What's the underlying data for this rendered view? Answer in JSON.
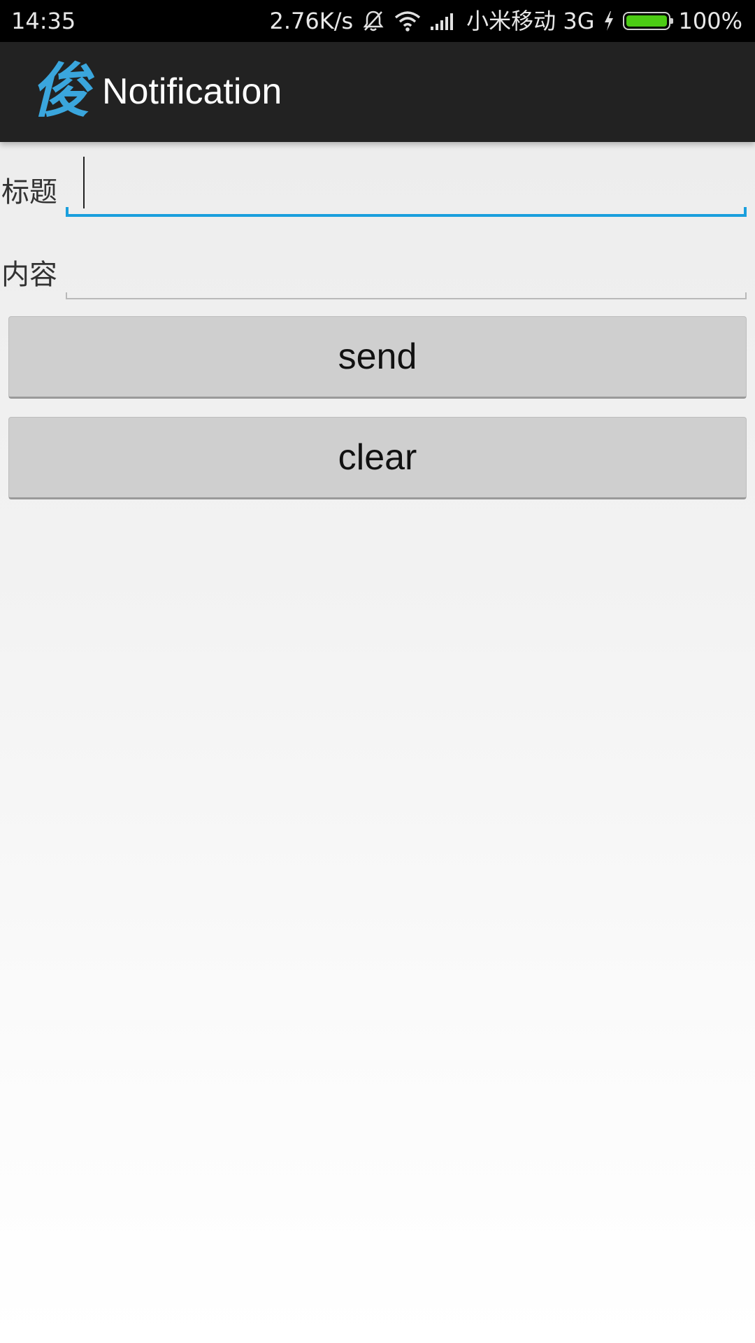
{
  "status_bar": {
    "time": "14:35",
    "net_speed": "2.76K/s",
    "carrier": "小米移动 3G",
    "battery": "100%",
    "icons": [
      "alarm-muted-icon",
      "wifi-icon",
      "signal-icon",
      "charging-icon",
      "battery-icon"
    ],
    "battery_color": "#4ccb14"
  },
  "action_bar": {
    "app_icon_glyph": "俊",
    "title": "Notification",
    "background": "#222222",
    "icon_color": "#3aa6dd"
  },
  "form": {
    "title_label": "标题",
    "title_value": "",
    "content_label": "内容",
    "content_value": "",
    "focus_color": "#1a9fdd"
  },
  "buttons": {
    "send": "send",
    "clear": "clear"
  }
}
